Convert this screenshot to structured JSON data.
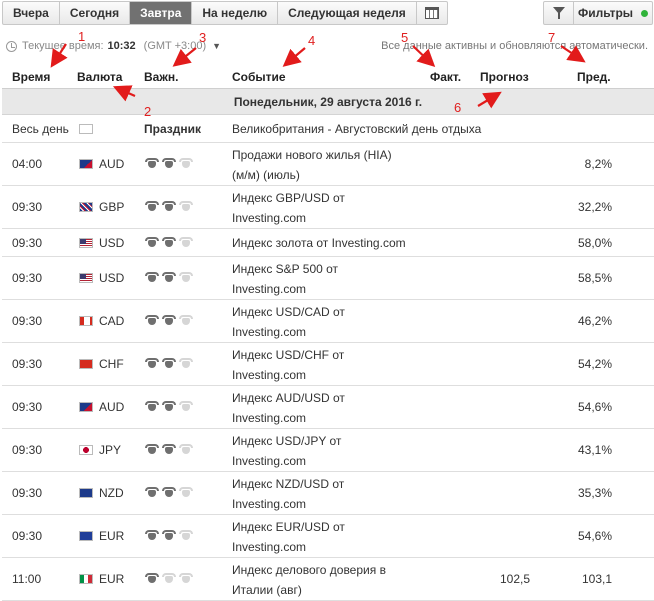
{
  "tabs": [
    {
      "label": "Вчера",
      "active": false
    },
    {
      "label": "Сегодня",
      "active": false
    },
    {
      "label": "Завтра",
      "active": true
    },
    {
      "label": "На неделю",
      "active": false
    },
    {
      "label": "Следующая неделя",
      "active": false
    }
  ],
  "filters_label": "Фильтры",
  "time": {
    "label": "Текущее время:",
    "value": "10:32",
    "zone": "(GMT +3:00)"
  },
  "auto_text": "Все данные активны и обновляются автоматически.",
  "columns": {
    "time": "Время",
    "currency": "Валюта",
    "importance": "Важн.",
    "event": "Событие",
    "actual": "Факт.",
    "forecast": "Прогноз",
    "previous": "Пред."
  },
  "day": "Понедельник, 29 августа 2016 г.",
  "holiday": {
    "time": "Весь день",
    "flag": "uk-flag",
    "type": "Праздник",
    "event": "Великобритания - Августовский день отдыха"
  },
  "annotations": [
    "1",
    "2",
    "3",
    "4",
    "5",
    "6",
    "7"
  ],
  "rows": [
    {
      "time": "04:00",
      "flag": "australia-flag",
      "currency": "AUD",
      "bulls": 2,
      "event1": "Продажи нового жилья (HIA)",
      "event2": "(м/м) (июль)",
      "forecast": "",
      "previous": "8,2%"
    },
    {
      "time": "09:30",
      "flag": "uk-flag",
      "currency": "GBP",
      "bulls": 2,
      "event1": "Индекс GBP/USD от",
      "event2": "Investing.com",
      "forecast": "",
      "previous": "32,2%"
    },
    {
      "time": "09:30",
      "flag": "us-flag",
      "currency": "USD",
      "bulls": 2,
      "event1": "Индекс золота от Investing.com",
      "event2": "",
      "forecast": "",
      "previous": "58,0%"
    },
    {
      "time": "09:30",
      "flag": "us-flag",
      "currency": "USD",
      "bulls": 2,
      "event1": "Индекс S&P 500 от",
      "event2": "Investing.com",
      "forecast": "",
      "previous": "58,5%"
    },
    {
      "time": "09:30",
      "flag": "canada-flag",
      "currency": "CAD",
      "bulls": 2,
      "event1": "Индекс USD/CAD от",
      "event2": "Investing.com",
      "forecast": "",
      "previous": "46,2%"
    },
    {
      "time": "09:30",
      "flag": "switzerland-flag",
      "currency": "CHF",
      "bulls": 2,
      "event1": "Индекс USD/CHF от",
      "event2": "Investing.com",
      "forecast": "",
      "previous": "54,2%"
    },
    {
      "time": "09:30",
      "flag": "australia-flag",
      "currency": "AUD",
      "bulls": 2,
      "event1": "Индекс AUD/USD от",
      "event2": "Investing.com",
      "forecast": "",
      "previous": "54,6%"
    },
    {
      "time": "09:30",
      "flag": "japan-flag",
      "currency": "JPY",
      "bulls": 2,
      "event1": "Индекс USD/JPY от",
      "event2": "Investing.com",
      "forecast": "",
      "previous": "43,1%"
    },
    {
      "time": "09:30",
      "flag": "newzealand-flag",
      "currency": "NZD",
      "bulls": 2,
      "event1": "Индекс NZD/USD от",
      "event2": "Investing.com",
      "forecast": "",
      "previous": "35,3%"
    },
    {
      "time": "09:30",
      "flag": "eu-flag",
      "currency": "EUR",
      "bulls": 2,
      "event1": "Индекс EUR/USD от",
      "event2": "Investing.com",
      "forecast": "",
      "previous": "54,6%"
    },
    {
      "time": "11:00",
      "flag": "italy-flag",
      "currency": "EUR",
      "bulls": 1,
      "event1": "Индекс делового доверия в",
      "event2": "Италии (авг)",
      "forecast": "102,5",
      "previous": "103,1"
    }
  ]
}
